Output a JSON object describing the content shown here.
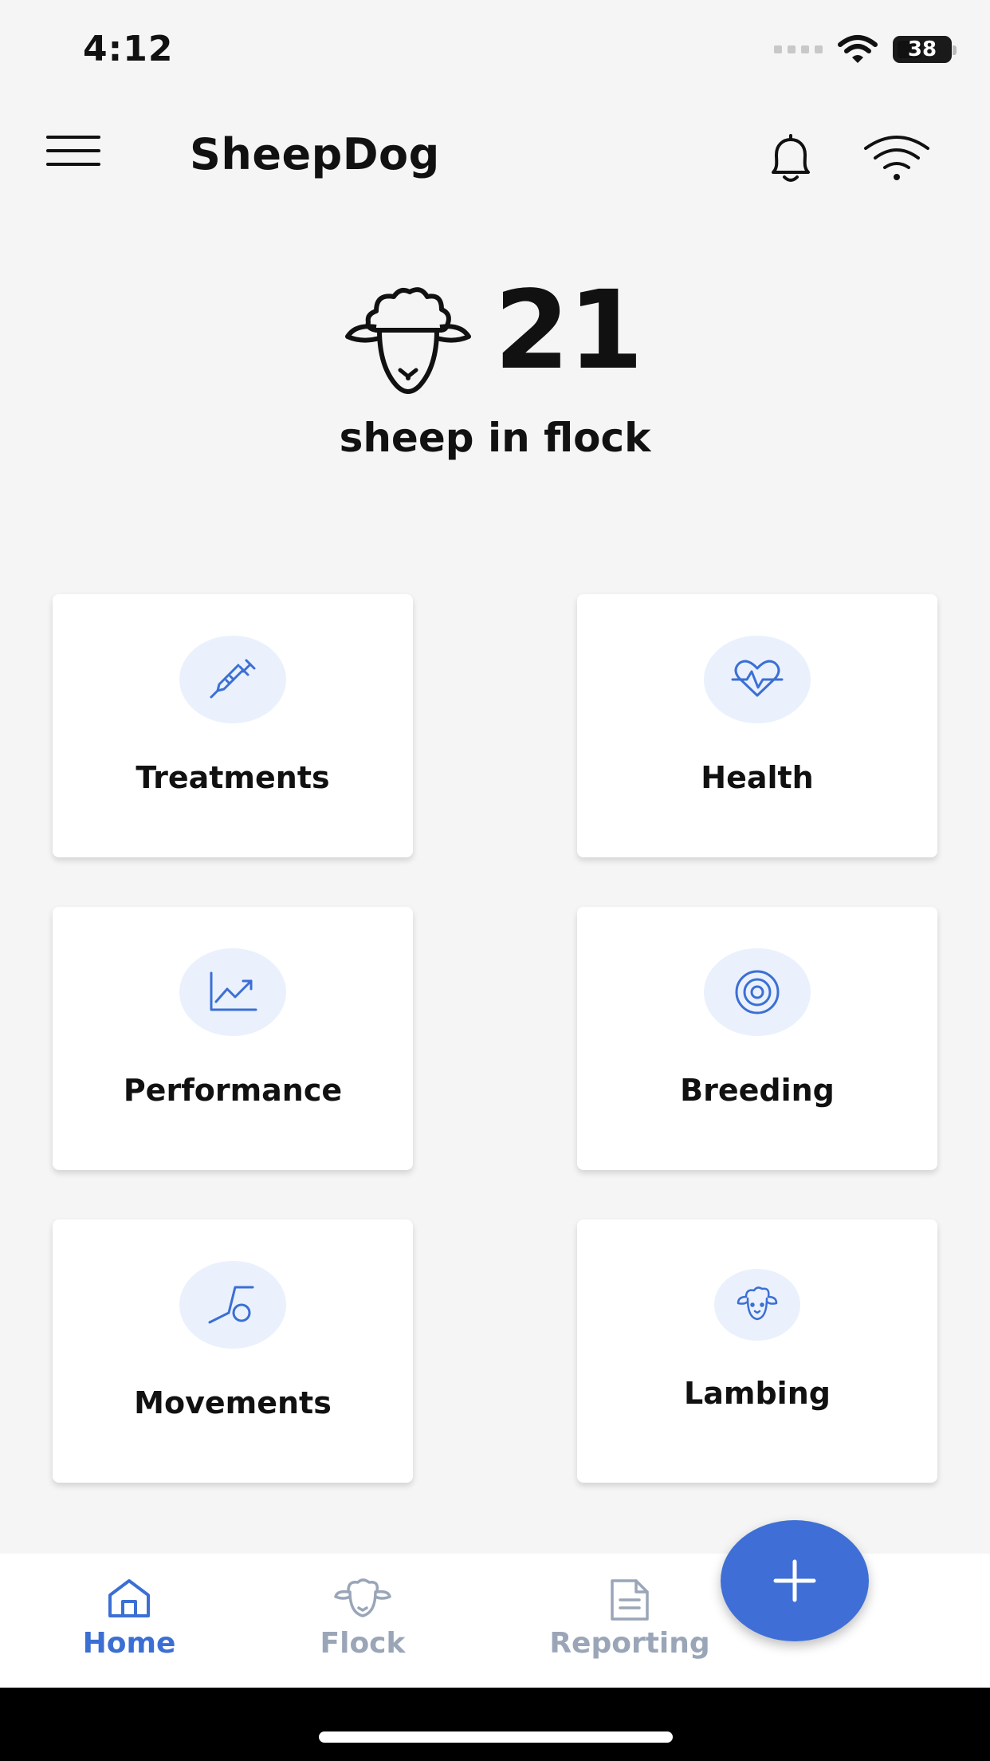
{
  "status_bar": {
    "time": "4:12",
    "battery": "38"
  },
  "header": {
    "title": "SheepDog",
    "icons": [
      "menu-icon",
      "bell-icon",
      "wifi-icon"
    ]
  },
  "flock": {
    "count": "21",
    "label": "sheep in flock"
  },
  "tiles": [
    {
      "label": "Treatments",
      "icon": "syringe-icon"
    },
    {
      "label": "Health",
      "icon": "heartbeat-icon"
    },
    {
      "label": "Performance",
      "icon": "chart-trend-icon"
    },
    {
      "label": "Breeding",
      "icon": "target-icon"
    },
    {
      "label": "Movements",
      "icon": "movement-icon"
    },
    {
      "label": "Lambing",
      "icon": "lamb-icon"
    }
  ],
  "nav": {
    "home": "Home",
    "flock": "Flock",
    "reporting": "Reporting"
  },
  "colors": {
    "accent": "#3f6fd6",
    "nav_active": "#3b6fd4",
    "nav_inactive": "#9aa6b8",
    "icon_bg": "#eaf1fc",
    "background": "#f5f5f5"
  }
}
